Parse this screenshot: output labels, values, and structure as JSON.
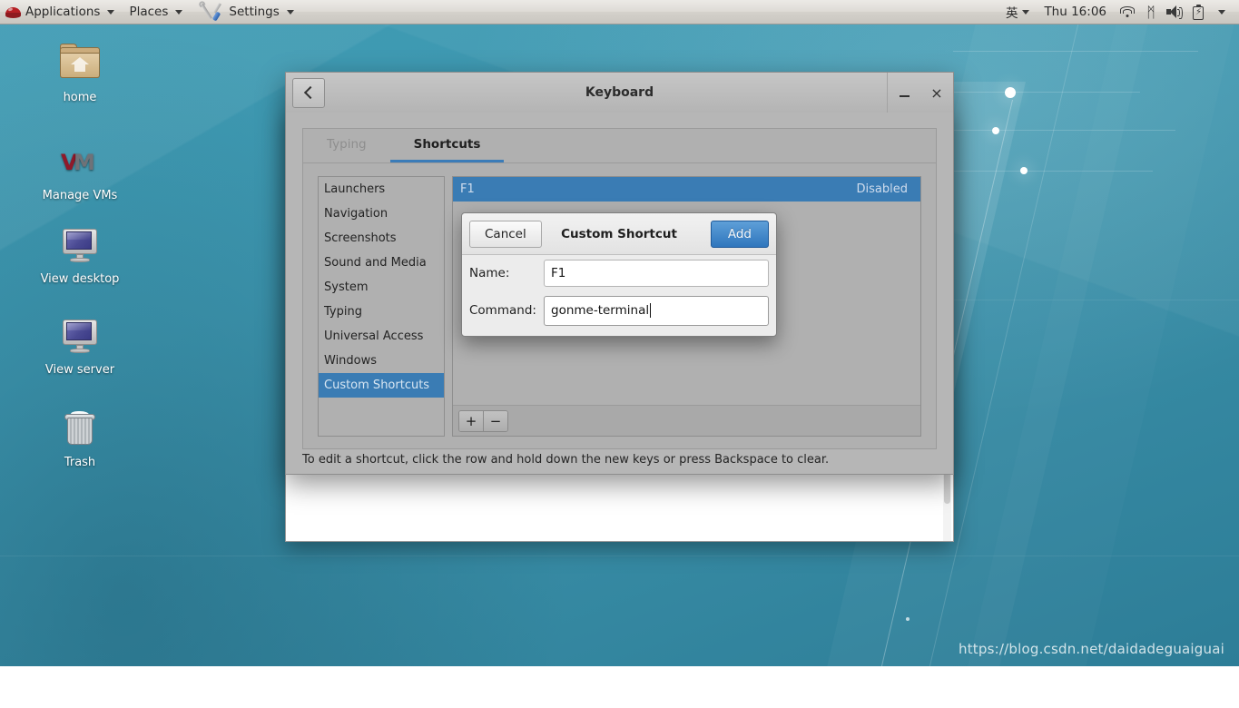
{
  "panel": {
    "menus": [
      {
        "label": "Applications",
        "icon": "redhat-logo-icon"
      },
      {
        "label": "Places",
        "icon": "none"
      }
    ],
    "window_task": {
      "label": "Settings",
      "icon": "tools-icon"
    },
    "input_method": "英",
    "clock": "Thu 16:06",
    "tray": [
      "wifi-icon",
      "bluetooth-icon",
      "volume-icon",
      "battery-icon",
      "chevron-down-icon"
    ],
    "bluetooth_glyph": "ᛗ"
  },
  "desktop": {
    "icons": [
      {
        "label": "home",
        "icon": "home-folder-icon"
      },
      {
        "label": "Manage VMs",
        "icon": "vmware-icon"
      },
      {
        "label": "View desktop",
        "icon": "monitor-icon"
      },
      {
        "label": "View server",
        "icon": "monitor-icon"
      },
      {
        "label": "Trash",
        "icon": "trash-icon"
      }
    ],
    "watermark": "https://blog.csdn.net/daidadeguaiguai"
  },
  "keyboard_window": {
    "title": "Keyboard",
    "back_button": "‹",
    "minimize_button": "–",
    "close_button": "×",
    "tabs": [
      {
        "label": "Typing",
        "active": false
      },
      {
        "label": "Shortcuts",
        "active": true
      }
    ],
    "categories": [
      "Launchers",
      "Navigation",
      "Screenshots",
      "Sound and Media",
      "System",
      "Typing",
      "Universal Access",
      "Windows",
      "Custom Shortcuts"
    ],
    "selected_category": "Custom Shortcuts",
    "shortcut_rows": [
      {
        "name": "F1",
        "accelerator": "Disabled",
        "selected": true
      }
    ],
    "toolbar": {
      "add_label": "+",
      "remove_label": "−"
    },
    "footer_hint": "To edit a shortcut, click the row and hold down the new keys or press Backspace to clear."
  },
  "custom_shortcut_dialog": {
    "title": "Custom Shortcut",
    "cancel_label": "Cancel",
    "add_label": "Add",
    "fields": [
      {
        "label": "Name:",
        "value": "F1",
        "focused": false
      },
      {
        "label": "Command:",
        "value": "gonme-terminal",
        "focused": true
      }
    ]
  },
  "colors": {
    "accent_blue": "#3a7cb4",
    "button_blue": "#2f76bd",
    "desktop_teal": "#3e97b0",
    "window_gray": "#b6b6b6",
    "panel_gray": "#dedbd6"
  }
}
